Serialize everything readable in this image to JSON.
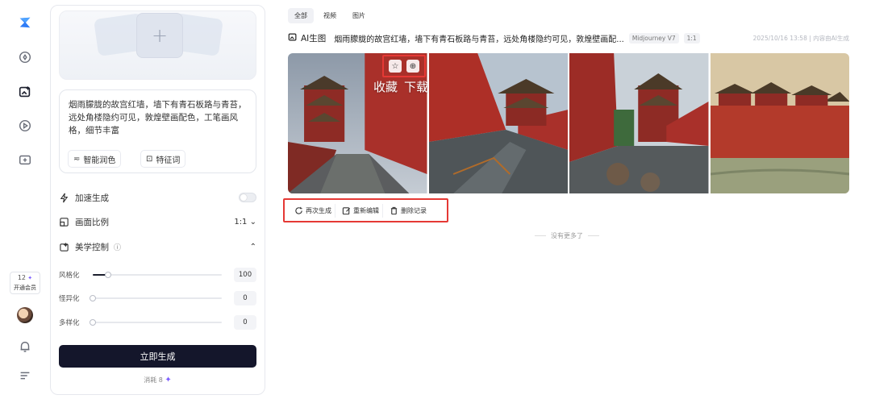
{
  "rail": {
    "vip_count": "12",
    "vip_label": "开通会员"
  },
  "panel": {
    "prompt_text": "烟雨朦胧的故宫红墙，墙下有青石板路与青苔，远处角楼隐约可见，敦煌壁画配色，工笔画风格，细节丰富",
    "chip_enhance": "智能润色",
    "chip_keywords": "特征词",
    "accelerate_label": "加速生成",
    "accelerate_on": false,
    "ratio_label": "画面比例",
    "ratio_value": "1:1",
    "aesthetic_label": "美学控制",
    "sliders": [
      {
        "label": "风格化",
        "value": "100",
        "fraction": 0.12
      },
      {
        "label": "怪异化",
        "value": "0",
        "fraction": 0
      },
      {
        "label": "多样化",
        "value": "0",
        "fraction": 0
      }
    ],
    "generate_label": "立即生成",
    "cost_label": "消耗 8"
  },
  "main": {
    "tabs": [
      "全部",
      "视频",
      "图片"
    ],
    "active_tab": 0,
    "ai_label": "AI生图",
    "prompt_title": "烟雨朦胧的故宫红墙，墙下有青石板路与青苔，远处角楼隐约可见，敦煌壁画配...",
    "model_tag": "Midjourney V7",
    "ratio_tag": "1:1",
    "meta": "2025/10/16 13:58 | 内容由AI生成",
    "hover_collect": "收藏",
    "hover_download": "下载",
    "actions": [
      "再次生成",
      "重新编辑",
      "删除记录"
    ],
    "no_more": "没有更多了"
  },
  "colors": {
    "accent_red": "#e53935",
    "primary_dark": "#14162b",
    "spark": "#7b5cff"
  }
}
